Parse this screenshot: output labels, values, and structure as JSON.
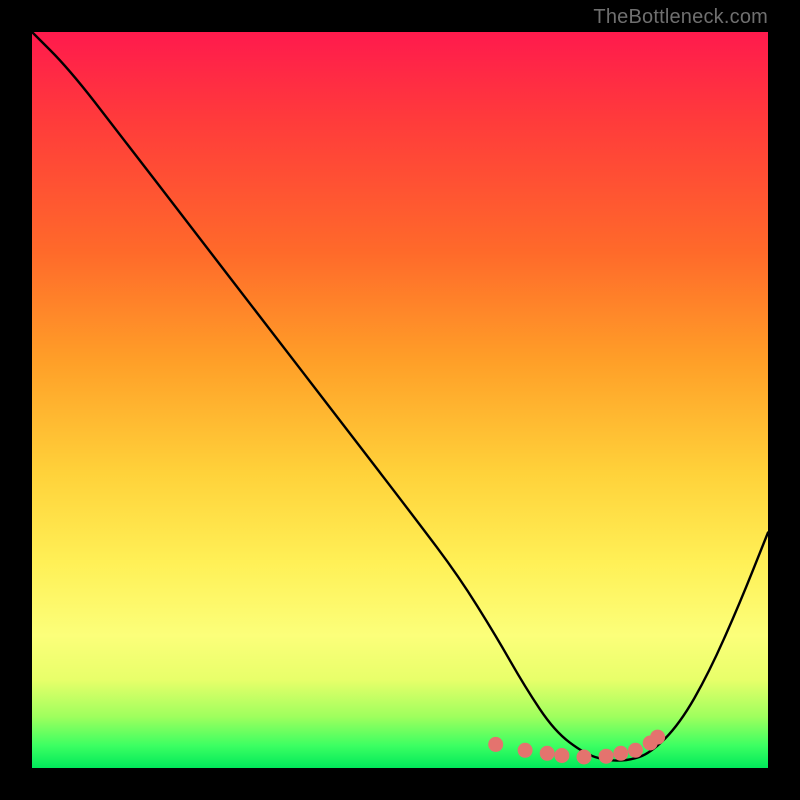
{
  "attribution": "TheBottleneck.com",
  "chart_data": {
    "type": "line",
    "title": "",
    "xlabel": "",
    "ylabel": "",
    "xlim": [
      0,
      100
    ],
    "ylim": [
      0,
      100
    ],
    "series": [
      {
        "name": "bottleneck-curve",
        "x": [
          0,
          5,
          12,
          22,
          32,
          42,
          52,
          58,
          63,
          67,
          71,
          75,
          78,
          81,
          84,
          88,
          92,
          96,
          100
        ],
        "y": [
          100,
          95,
          86,
          73,
          60,
          47,
          34,
          26,
          18,
          11,
          5,
          2,
          1,
          1,
          2,
          6,
          13,
          22,
          32
        ],
        "color": "#000000"
      }
    ],
    "markers": {
      "name": "valley-markers",
      "color": "#e4736e",
      "points": [
        {
          "x": 63,
          "y": 3.2
        },
        {
          "x": 67,
          "y": 2.4
        },
        {
          "x": 70,
          "y": 2.0
        },
        {
          "x": 72,
          "y": 1.7
        },
        {
          "x": 75,
          "y": 1.5
        },
        {
          "x": 78,
          "y": 1.6
        },
        {
          "x": 80,
          "y": 2.0
        },
        {
          "x": 82,
          "y": 2.4
        },
        {
          "x": 84,
          "y": 3.4
        },
        {
          "x": 85,
          "y": 4.2
        }
      ]
    }
  }
}
